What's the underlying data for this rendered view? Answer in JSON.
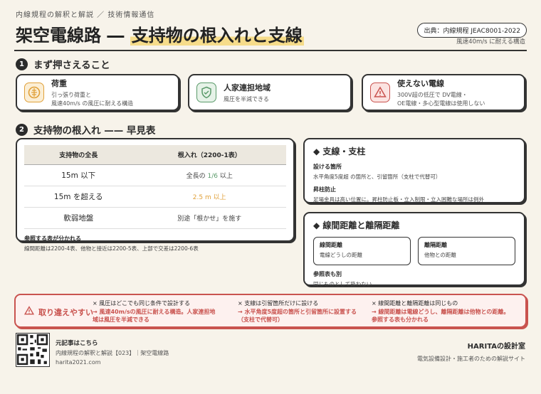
{
  "header": {
    "eyebrow": "内線規程の解釈と解説 ／ 技術情報通信",
    "title_main": "架空電線路 ― ",
    "title_highlight": "支持物の根入れと支線",
    "source": "出典：内線規程 JEAC8001-2022",
    "source_note": "風速40m/s に耐える構造"
  },
  "section1": {
    "number": "1",
    "title": "まず押さえること",
    "cards": [
      {
        "icon": "load-icon",
        "title": "荷重",
        "desc1": "引っ張り荷重と",
        "desc2": "風速40m/s の風圧に耐える構造"
      },
      {
        "icon": "shield-check-icon",
        "title": "人家連担地域",
        "desc1": "風圧を半減できる",
        "desc2": ""
      },
      {
        "icon": "warning-icon",
        "title": "使えない電線",
        "desc1": "300V超の低圧で DV電線・",
        "desc2": "OE電線・多心型電線は使用しない"
      }
    ]
  },
  "section2": {
    "number": "2",
    "title": "支持物の根入れ —— 早見表",
    "table": {
      "headers": [
        "支持物の全長",
        "根入れ（2200-1表）"
      ],
      "rows": [
        {
          "length": "15m 以下",
          "depth_pre": "全長の ",
          "depth_hl": "1/6",
          "depth_post": " 以上"
        },
        {
          "length": "15m を超える",
          "depth_pre": "",
          "depth_hl": "2.5 m",
          "depth_post": " 以上"
        },
        {
          "length": "軟弱地盤",
          "depth_pre": "別途「根かせ」を施す",
          "depth_hl": "",
          "depth_post": ""
        }
      ],
      "ref_title": "参照する表が分かれる",
      "ref_desc": "線間距離は2200-4表、他物と接近は2200-5表、上部で交差は2200-6表"
    }
  },
  "panel_shisen": {
    "title": "支線・支柱",
    "items": [
      {
        "title": "設ける箇所",
        "desc": "水平角度5度超 の箇所と、引留箇所（支柱で代替可）"
      },
      {
        "title": "昇柱防止",
        "desc": "足場金具は高い位置に。昇柱防止板・立入制限・立入困難な場所は例外"
      }
    ]
  },
  "panel_distance": {
    "title": "線間距離と離隔距離",
    "left": {
      "title": "線間距離",
      "desc": "電線どうしの距離"
    },
    "right": {
      "title": "離隔距離",
      "desc": "他物との距離"
    },
    "ref_title": "参照表も別",
    "ref_desc": "同じものとして扱わない"
  },
  "warnings": {
    "label": "取り違えやすい",
    "items": [
      {
        "wrong": "× 風圧はどこでも同じ条件で設計する",
        "right1": "→ 風速40m/sの風圧に耐える構造。人家連担地",
        "right2": "域は風圧を半減できる"
      },
      {
        "wrong": "× 支線は引留箇所だけに設ける",
        "right1": "→ 水平角度5度超の箇所と引留箇所に設置する",
        "right2": "（支柱で代替可）"
      },
      {
        "wrong": "× 線間距離と離隔距離は同じもの",
        "right1": "→ 線間距離は電線どうし、離隔距離は他物との距離。",
        "right2": "参照する表も分かれる"
      }
    ]
  },
  "footer": {
    "link_title": "元記事はこちら",
    "link_desc": "内線規程の解釈と解説【023】｜架空電線路",
    "url": "harita2021.com",
    "brand": "HARITAの設計室",
    "tagline": "電気設備設計・施工者のための解説サイト"
  },
  "colors": {
    "ink": "#2b2b2b",
    "accent_red": "#c9534f",
    "accent_orange": "#e0a13a",
    "accent_green": "#5a9a6a",
    "highlight": "#f6dc8a"
  }
}
